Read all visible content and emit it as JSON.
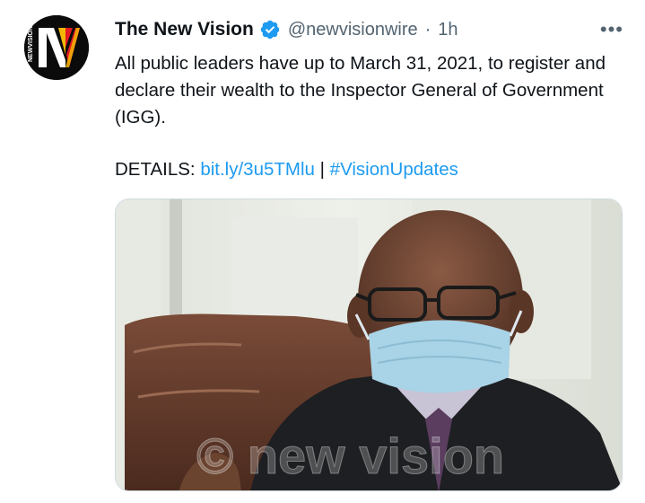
{
  "tweet": {
    "display_name": "The New Vision",
    "handle": "@newvisionwire",
    "separator": "·",
    "time": "1h",
    "more_label": "•••",
    "text": "All public leaders have up to March 31, 2021, to register and declare their wealth to the Inspector General of Government (IGG).",
    "details_label": "DETAILS:",
    "link_url": "bit.ly/3u5TMlu",
    "pipe": "|",
    "hashtag": "#VisionUpdates",
    "media_watermark": "© new vision"
  },
  "avatar": {
    "logo": "N",
    "side_text": "NEWVISION"
  },
  "icons": {
    "verified": "verified-badge-icon",
    "more": "more-options-icon"
  },
  "colors": {
    "link": "#1d9bf0",
    "secondary": "#536471",
    "verified": "#1d9bf0"
  }
}
